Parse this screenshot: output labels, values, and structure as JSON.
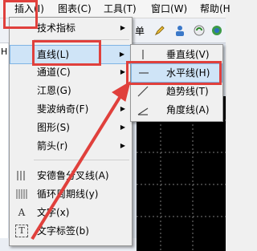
{
  "menubar": {
    "items": [
      {
        "label": "插入(I)"
      },
      {
        "label": "图表(C)"
      },
      {
        "label": "工具(T)"
      },
      {
        "label": "窗口(W)"
      },
      {
        "label": "帮助(H"
      }
    ]
  },
  "toolbar": {
    "partial_text": "单"
  },
  "left_strip": {
    "label": "H"
  },
  "insert_menu": {
    "items": [
      {
        "label": "技术指标",
        "has_submenu": true
      },
      {
        "label": "直线(L)",
        "has_submenu": true,
        "highlighted": true
      },
      {
        "label": "通道(C)",
        "has_submenu": true
      },
      {
        "label": "江恩(G)",
        "has_submenu": true
      },
      {
        "label": "斐波纳奇(F)",
        "has_submenu": true
      },
      {
        "label": "图形(S)",
        "has_submenu": true
      },
      {
        "label": "箭头(r)",
        "has_submenu": true
      },
      {
        "label": "安德鲁分叉线(A)",
        "icon": "pitchfork-icon"
      },
      {
        "label": "循环周期线(y)",
        "icon": "cycle-lines-icon"
      },
      {
        "label": "文字(x)",
        "icon": "text-icon",
        "icon_glyph": "A"
      },
      {
        "label": "文字标签(b)",
        "icon": "text-label-icon",
        "icon_glyph": "T"
      }
    ]
  },
  "line_submenu": {
    "items": [
      {
        "label": "垂直线(V)",
        "icon": "vertical-line-icon"
      },
      {
        "label": "水平线(H)",
        "icon": "horizontal-line-icon",
        "highlighted": true
      },
      {
        "label": "趋势线(T)",
        "icon": "trendline-icon"
      },
      {
        "label": "角度线(A)",
        "icon": "angle-line-icon"
      }
    ]
  },
  "colors": {
    "annotation": "#e0403c",
    "highlight": "#cfe4f7",
    "chart_bg": "#000000"
  }
}
